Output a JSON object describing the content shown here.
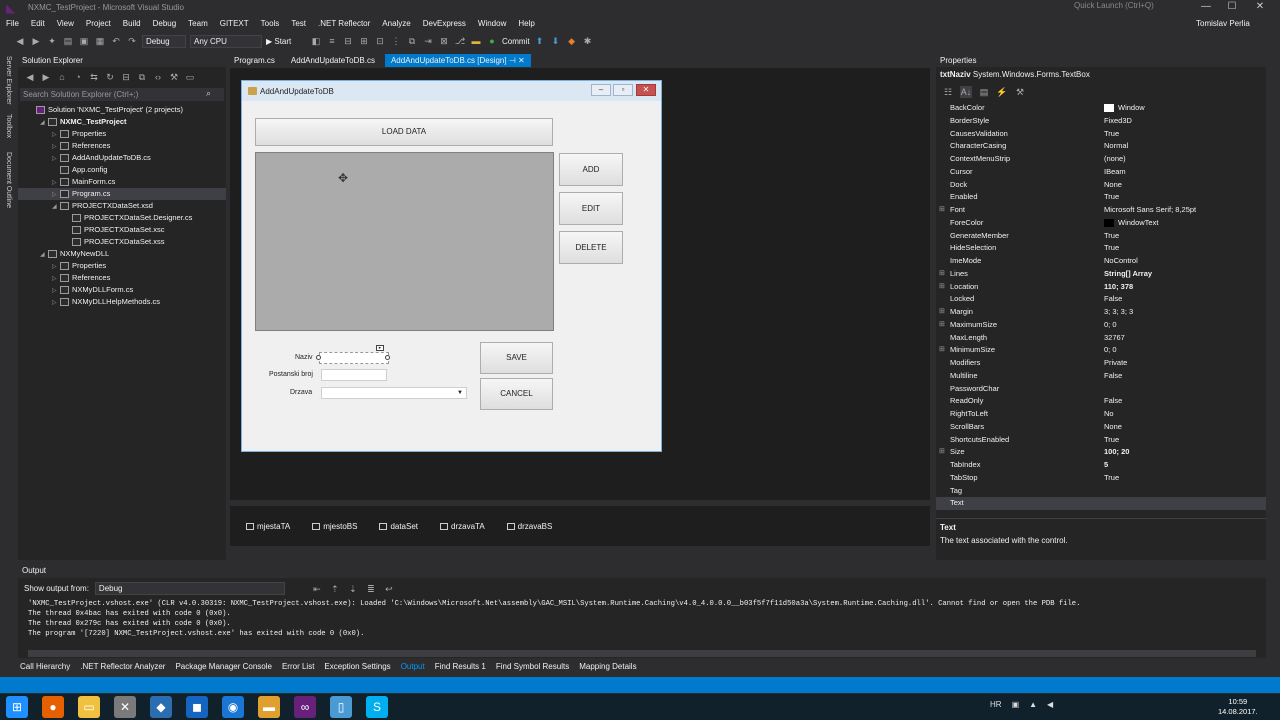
{
  "window": {
    "title": "NXMC_TestProject - Microsoft Visual Studio",
    "quick_launch": "Quick Launch (Ctrl+Q)",
    "user": "Tomislav Perlia",
    "min": "—",
    "max": "☐",
    "close": "✕"
  },
  "menu": [
    "File",
    "Edit",
    "View",
    "Project",
    "Build",
    "Debug",
    "Team",
    "GITEXT",
    "Tools",
    "Test",
    ".NET Reflector",
    "Analyze",
    "DevExpress",
    "Window",
    "Help"
  ],
  "toolbar": {
    "config": "Debug",
    "platform": "Any CPU",
    "start": "▶ Start",
    "commit": "Commit"
  },
  "left_strip": [
    "Server Explorer",
    "Toolbox",
    "Document Outline"
  ],
  "solution_explorer": {
    "title": "Solution Explorer",
    "search_placeholder": "Search Solution Explorer (Ctrl+;)",
    "items": [
      {
        "label": "Solution 'NXMC_TestProject' (2 projects)",
        "indent": 0,
        "arrow": "",
        "bold": false,
        "selected": false
      },
      {
        "label": "NXMC_TestProject",
        "indent": 1,
        "arrow": "◢",
        "bold": true,
        "selected": false
      },
      {
        "label": "Properties",
        "indent": 2,
        "arrow": "▷",
        "bold": false,
        "selected": false
      },
      {
        "label": "References",
        "indent": 2,
        "arrow": "▷",
        "bold": false,
        "selected": false
      },
      {
        "label": "AddAndUpdateToDB.cs",
        "indent": 2,
        "arrow": "▷",
        "bold": false,
        "selected": false
      },
      {
        "label": "App.config",
        "indent": 2,
        "arrow": "",
        "bold": false,
        "selected": false
      },
      {
        "label": "MainForm.cs",
        "indent": 2,
        "arrow": "▷",
        "bold": false,
        "selected": false
      },
      {
        "label": "Program.cs",
        "indent": 2,
        "arrow": "▷",
        "bold": false,
        "selected": true
      },
      {
        "label": "PROJECTXDataSet.xsd",
        "indent": 2,
        "arrow": "◢",
        "bold": false,
        "selected": false
      },
      {
        "label": "PROJECTXDataSet.Designer.cs",
        "indent": 3,
        "arrow": "",
        "bold": false,
        "selected": false
      },
      {
        "label": "PROJECTXDataSet.xsc",
        "indent": 3,
        "arrow": "",
        "bold": false,
        "selected": false
      },
      {
        "label": "PROJECTXDataSet.xss",
        "indent": 3,
        "arrow": "",
        "bold": false,
        "selected": false
      },
      {
        "label": "NXMyNewDLL",
        "indent": 1,
        "arrow": "◢",
        "bold": false,
        "selected": false
      },
      {
        "label": "Properties",
        "indent": 2,
        "arrow": "▷",
        "bold": false,
        "selected": false
      },
      {
        "label": "References",
        "indent": 2,
        "arrow": "▷",
        "bold": false,
        "selected": false
      },
      {
        "label": "NXMyDLLForm.cs",
        "indent": 2,
        "arrow": "▷",
        "bold": false,
        "selected": false
      },
      {
        "label": "NXMyDLLHelpMethods.cs",
        "indent": 2,
        "arrow": "▷",
        "bold": false,
        "selected": false
      }
    ]
  },
  "doc_tabs": [
    {
      "label": "Program.cs",
      "active": false
    },
    {
      "label": "AddAndUpdateToDB.cs",
      "active": false
    },
    {
      "label": "AddAndUpdateToDB.cs [Design]",
      "active": true
    }
  ],
  "form": {
    "title": "AddAndUpdateToDB",
    "load_data": "LOAD DATA",
    "add": "ADD",
    "edit": "EDIT",
    "delete": "DELETE",
    "save": "SAVE",
    "cancel": "CANCEL",
    "label_naziv": "Naziv",
    "label_postanski": "Postanski broj",
    "label_drzava": "Drzava"
  },
  "tray": [
    "mjestaTA",
    "mjestoBS",
    "dataSet",
    "drzavaTA",
    "drzavaBS"
  ],
  "properties": {
    "title": "Properties",
    "object_name": "txtNaziv",
    "object_type": "System.Windows.Forms.TextBox",
    "rows": [
      {
        "name": "BackColor",
        "value": "Window",
        "swatch": "#ffffff",
        "exp": "",
        "bold": false
      },
      {
        "name": "BorderStyle",
        "value": "Fixed3D",
        "swatch": "",
        "exp": "",
        "bold": false
      },
      {
        "name": "CausesValidation",
        "value": "True",
        "swatch": "",
        "exp": "",
        "bold": false
      },
      {
        "name": "CharacterCasing",
        "value": "Normal",
        "swatch": "",
        "exp": "",
        "bold": false
      },
      {
        "name": "ContextMenuStrip",
        "value": "(none)",
        "swatch": "",
        "exp": "",
        "bold": false
      },
      {
        "name": "Cursor",
        "value": "IBeam",
        "swatch": "",
        "exp": "",
        "bold": false
      },
      {
        "name": "Dock",
        "value": "None",
        "swatch": "",
        "exp": "",
        "bold": false
      },
      {
        "name": "Enabled",
        "value": "True",
        "swatch": "",
        "exp": "",
        "bold": false
      },
      {
        "name": "Font",
        "value": "Microsoft Sans Serif; 8,25pt",
        "swatch": "",
        "exp": "⊞",
        "bold": false
      },
      {
        "name": "ForeColor",
        "value": "WindowText",
        "swatch": "#000000",
        "exp": "",
        "bold": false
      },
      {
        "name": "GenerateMember",
        "value": "True",
        "swatch": "",
        "exp": "",
        "bold": false
      },
      {
        "name": "HideSelection",
        "value": "True",
        "swatch": "",
        "exp": "",
        "bold": false
      },
      {
        "name": "ImeMode",
        "value": "NoControl",
        "swatch": "",
        "exp": "",
        "bold": false
      },
      {
        "name": "Lines",
        "value": "String[] Array",
        "swatch": "",
        "exp": "⊞",
        "bold": true
      },
      {
        "name": "Location",
        "value": "110; 378",
        "swatch": "",
        "exp": "⊞",
        "bold": true
      },
      {
        "name": "Locked",
        "value": "False",
        "swatch": "",
        "exp": "",
        "bold": false
      },
      {
        "name": "Margin",
        "value": "3; 3; 3; 3",
        "swatch": "",
        "exp": "⊞",
        "bold": false
      },
      {
        "name": "MaximumSize",
        "value": "0; 0",
        "swatch": "",
        "exp": "⊞",
        "bold": false
      },
      {
        "name": "MaxLength",
        "value": "32767",
        "swatch": "",
        "exp": "",
        "bold": false
      },
      {
        "name": "MinimumSize",
        "value": "0; 0",
        "swatch": "",
        "exp": "⊞",
        "bold": false
      },
      {
        "name": "Modifiers",
        "value": "Private",
        "swatch": "",
        "exp": "",
        "bold": false
      },
      {
        "name": "Multiline",
        "value": "False",
        "swatch": "",
        "exp": "",
        "bold": false
      },
      {
        "name": "PasswordChar",
        "value": "",
        "swatch": "",
        "exp": "",
        "bold": false
      },
      {
        "name": "ReadOnly",
        "value": "False",
        "swatch": "",
        "exp": "",
        "bold": false
      },
      {
        "name": "RightToLeft",
        "value": "No",
        "swatch": "",
        "exp": "",
        "bold": false
      },
      {
        "name": "ScrollBars",
        "value": "None",
        "swatch": "",
        "exp": "",
        "bold": false
      },
      {
        "name": "ShortcutsEnabled",
        "value": "True",
        "swatch": "",
        "exp": "",
        "bold": false
      },
      {
        "name": "Size",
        "value": "100; 20",
        "swatch": "",
        "exp": "⊞",
        "bold": true
      },
      {
        "name": "TabIndex",
        "value": "5",
        "swatch": "",
        "exp": "",
        "bold": true
      },
      {
        "name": "TabStop",
        "value": "True",
        "swatch": "",
        "exp": "",
        "bold": false
      },
      {
        "name": "Tag",
        "value": "",
        "swatch": "",
        "exp": "",
        "bold": false
      },
      {
        "name": "Text",
        "value": "",
        "swatch": "",
        "exp": "",
        "bold": false,
        "selected": true
      }
    ],
    "desc_title": "Text",
    "desc_text": "The text associated with the control."
  },
  "output": {
    "title": "Output",
    "show_from_label": "Show output from:",
    "show_from_value": "Debug",
    "lines": [
      "'NXMC_TestProject.vshost.exe' (CLR v4.0.30319: NXMC_TestProject.vshost.exe): Loaded 'C:\\Windows\\Microsoft.Net\\assembly\\GAC_MSIL\\System.Runtime.Caching\\v4.0_4.0.0.0__b03f5f7f11d50a3a\\System.Runtime.Caching.dll'. Cannot find or open the PDB file.",
      "The thread 0x4bac has exited with code 0 (0x0).",
      "The thread 0x279c has exited with code 0 (0x0).",
      "The program '[7220] NXMC_TestProject.vshost.exe' has exited with code 0 (0x0)."
    ]
  },
  "bottom_tabs": [
    {
      "label": "Call Hierarchy",
      "active": false
    },
    {
      "label": ".NET Reflector Analyzer",
      "active": false
    },
    {
      "label": "Package Manager Console",
      "active": false
    },
    {
      "label": "Error List",
      "active": false
    },
    {
      "label": "Exception Settings",
      "active": false
    },
    {
      "label": "Output",
      "active": true
    },
    {
      "label": "Find Results 1",
      "active": false
    },
    {
      "label": "Find Symbol Results",
      "active": false
    },
    {
      "label": "Mapping Details",
      "active": false
    }
  ],
  "taskbar": {
    "icons": [
      {
        "name": "windows-start-icon",
        "glyph": "⊞",
        "color": "#1e90ff"
      },
      {
        "name": "firefox-icon",
        "glyph": "●",
        "color": "#e66000"
      },
      {
        "name": "file-explorer-icon",
        "glyph": "▭",
        "color": "#f0c040"
      },
      {
        "name": "tools-icon",
        "glyph": "✕",
        "color": "#7a7a7a"
      },
      {
        "name": "app-icon",
        "glyph": "◆",
        "color": "#2a6db0"
      },
      {
        "name": "outlook-icon",
        "glyph": "◼",
        "color": "#1565c0"
      },
      {
        "name": "chrome-icon",
        "glyph": "◉",
        "color": "#1976d2"
      },
      {
        "name": "folder-icon",
        "glyph": "▬",
        "color": "#e0a030"
      },
      {
        "name": "visual-studio-icon",
        "glyph": "∞",
        "color": "#68217a"
      },
      {
        "name": "notepad-icon",
        "glyph": "▯",
        "color": "#4a9ad4"
      },
      {
        "name": "skype-icon",
        "glyph": "S",
        "color": "#00aff0"
      }
    ],
    "lang": "HR",
    "time": "10:59",
    "date": "14.08.2017."
  }
}
